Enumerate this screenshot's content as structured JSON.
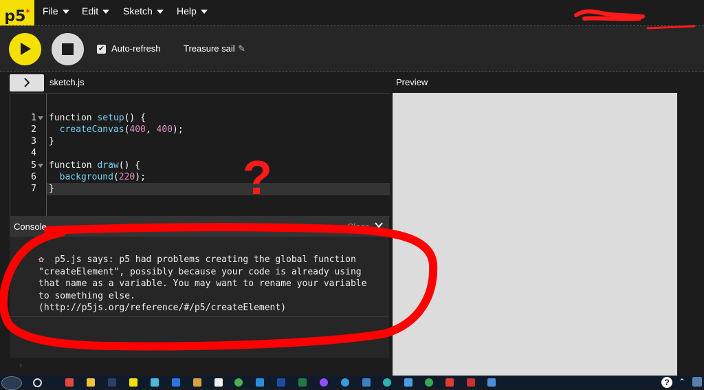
{
  "nav": {
    "logo_text": "p5",
    "logo_star": "*",
    "menus": [
      "File",
      "Edit",
      "Sketch",
      "Help"
    ]
  },
  "toolbar": {
    "play_icon": "play-icon",
    "stop_icon": "stop-icon",
    "auto_refresh_label": "Auto-refresh",
    "auto_refresh_checked": true,
    "sketch_name": "Treasure sail",
    "edit_icon": "pencil-icon"
  },
  "editor": {
    "file_name": "sketch.js",
    "preview_label": "Preview",
    "lines": [
      {
        "n": "1",
        "text": "function setup() {"
      },
      {
        "n": "2",
        "text": "  createCanvas(400, 400);"
      },
      {
        "n": "3",
        "text": "}"
      },
      {
        "n": "4",
        "text": ""
      },
      {
        "n": "5",
        "text": "function draw() {"
      },
      {
        "n": "6",
        "text": "  background(220);"
      },
      {
        "n": "7",
        "text": "}"
      }
    ]
  },
  "console": {
    "title": "Console",
    "close_label": "Clear",
    "icon": "flower-icon",
    "message": "p5.js says: p5 had problems creating the global function \"createElement\", possibly because your code is already using that name as a variable. You may want to rename your variable to something else. (http://p5js.org/reference/#/p5/createElement)"
  },
  "annotation": {
    "mark": "?"
  },
  "colors": {
    "brand_yellow": "#f5e003",
    "brand_pink": "#ed225d",
    "scribble_red": "#ff0000",
    "preview_bg": "#dcdcdc"
  }
}
